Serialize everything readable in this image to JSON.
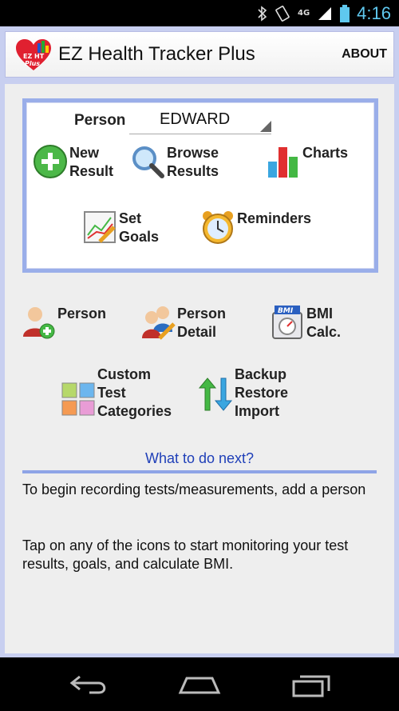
{
  "status_bar": {
    "network": "4G",
    "time": "4:16"
  },
  "header": {
    "title": "EZ Health Tracker Plus",
    "about_label": "ABOUT"
  },
  "panel": {
    "person_label": "Person",
    "person_value": "EDWARD",
    "tiles": {
      "new_result": "New\nResult",
      "browse_results": "Browse\nResults",
      "charts": "Charts",
      "set_goals": "Set\nGoals",
      "reminders": "Reminders"
    }
  },
  "tools": {
    "person": "Person",
    "person_detail": "Person\nDetail",
    "bmi_calc": "BMI\nCalc.",
    "custom_categories": "Custom\nTest\nCategories",
    "backup": "Backup\nRestore\nImport"
  },
  "next": {
    "title": "What to do next?",
    "message1": "To begin recording tests/measurements, add a person",
    "message2": "Tap on any of the icons to start monitoring your test results, goals, and calculate BMI."
  },
  "colors": {
    "accent": "#9aaee9",
    "link": "#1f3fb8",
    "background": "#eeeeee"
  }
}
